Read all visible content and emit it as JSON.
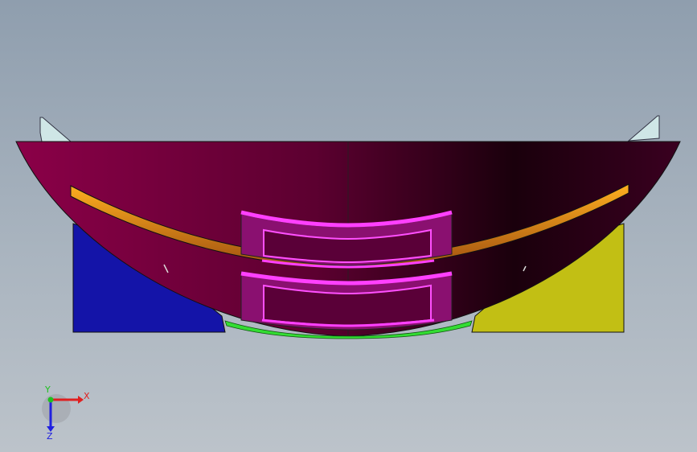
{
  "viewport": {
    "background_top": "#8f9eae",
    "background_bottom": "#bcc3ca"
  },
  "model": {
    "shell_color_left": "#8b0048",
    "shell_color_right": "#0a0006",
    "left_block_color": "#1414a8",
    "right_block_color": "#c2bf14",
    "strip_color": "#e8901a",
    "bracket_color": "#e020e0",
    "bottom_strip_color": "#33dd33"
  },
  "triad": {
    "x_label": "X",
    "y_label": "Y",
    "z_label": "Z",
    "x_color": "#e02020",
    "y_color": "#20c020",
    "z_color": "#2020e0"
  }
}
